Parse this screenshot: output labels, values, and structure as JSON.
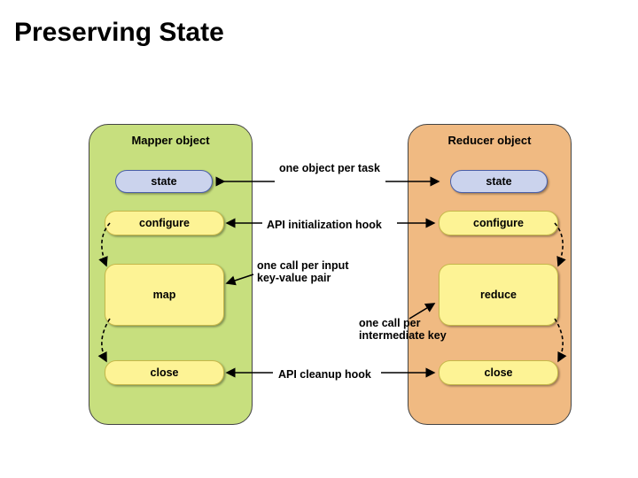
{
  "title": "Preserving State",
  "left": {
    "title": "Mapper object",
    "state": "state",
    "configure": "configure",
    "map": "map",
    "close": "close"
  },
  "right": {
    "title": "Reducer object",
    "state": "state",
    "configure": "configure",
    "reduce": "reduce",
    "close": "close"
  },
  "labels": {
    "one_object": "one object per task",
    "api_init": "API initialization hook",
    "one_call_input": "one call per input\nkey-value pair",
    "one_call_intermediate": "one call per\nintermediate key",
    "api_cleanup": "API cleanup hook"
  }
}
